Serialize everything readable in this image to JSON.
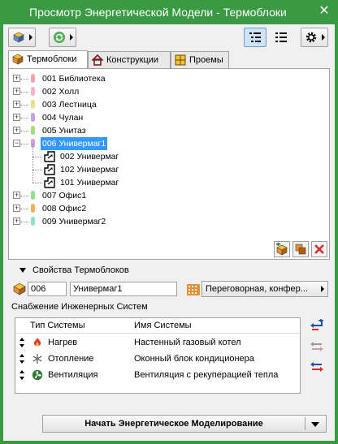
{
  "window": {
    "title": "Просмотр Энергетической Модели - Термоблоки",
    "close_glyph": "✕"
  },
  "toolbar": {
    "left": [
      {
        "name": "model-icon"
      },
      {
        "name": "refresh-icon"
      }
    ],
    "right": [
      {
        "name": "list-view-icon",
        "active": true
      },
      {
        "name": "detail-view-icon",
        "active": false
      },
      {
        "name": "gear-icon"
      }
    ]
  },
  "tabs": [
    {
      "label": "Термоблоки",
      "active": true,
      "icon": "zone-icon"
    },
    {
      "label": "Конструкции",
      "active": false,
      "icon": "house-icon"
    },
    {
      "label": "Проемы",
      "active": false,
      "icon": "window-icon"
    }
  ],
  "tree": [
    {
      "level": 0,
      "code": "001",
      "name": "Библиотека",
      "color": "#f0a8a8",
      "expander": "+"
    },
    {
      "level": 0,
      "code": "002",
      "name": "Холл",
      "color": "#f3b6c8",
      "expander": "+"
    },
    {
      "level": 0,
      "code": "003",
      "name": "Лестница",
      "color": "#ede08a",
      "expander": "+"
    },
    {
      "level": 0,
      "code": "004",
      "name": "Чулан",
      "color": "#c5a2e0",
      "expander": "+"
    },
    {
      "level": 0,
      "code": "005",
      "name": "Унитаз",
      "color": "#a8d880",
      "expander": "+"
    },
    {
      "level": 0,
      "code": "006",
      "name": "Универмаг1",
      "color": "#d89ad8",
      "expander": "−",
      "selected": true
    },
    {
      "level": 1,
      "code": "002",
      "name": "Универмаг"
    },
    {
      "level": 1,
      "code": "102",
      "name": "Универмаг"
    },
    {
      "level": 1,
      "code": "101",
      "name": "Универмаг"
    },
    {
      "level": 0,
      "code": "007",
      "name": "Офис1",
      "color": "#8fe08f",
      "expander": "+"
    },
    {
      "level": 0,
      "code": "008",
      "name": "Офис2",
      "color": "#f0b060",
      "expander": "+"
    },
    {
      "level": 0,
      "code": "009",
      "name": "Универмаг2",
      "color": "#8fe0c8",
      "expander": "+"
    }
  ],
  "tree_actions": [
    {
      "name": "add-zone-icon"
    },
    {
      "name": "merge-zones-icon"
    },
    {
      "name": "delete-icon"
    }
  ],
  "properties": {
    "header": "Свойства Термоблоков",
    "number_value": "006",
    "name_value": "Универмаг1",
    "category_value": "Переговорная, конфер..."
  },
  "systems": {
    "header": "Снабжение Инженерных Систем",
    "columns": [
      "Тип Системы",
      "Имя Системы"
    ],
    "rows": [
      {
        "type": "Нагрев",
        "name": "Настенный газовый котел",
        "icon": "flame-icon"
      },
      {
        "type": "Отопление",
        "name": "Оконный блок кондиционера",
        "icon": "snowflake-icon"
      },
      {
        "type": "Вентиляция",
        "name": "Вентиляция с рекуперацией тепла",
        "icon": "fan-icon"
      }
    ],
    "side_buttons": [
      {
        "name": "add-system-icon"
      },
      {
        "name": "swap-gray-icon"
      },
      {
        "name": "swap-color-icon"
      }
    ]
  },
  "start_button": {
    "label": "Начать Энергетическое Моделирование"
  },
  "colors": {
    "titlebar": "#3a9a44",
    "selection": "#3399ff"
  }
}
